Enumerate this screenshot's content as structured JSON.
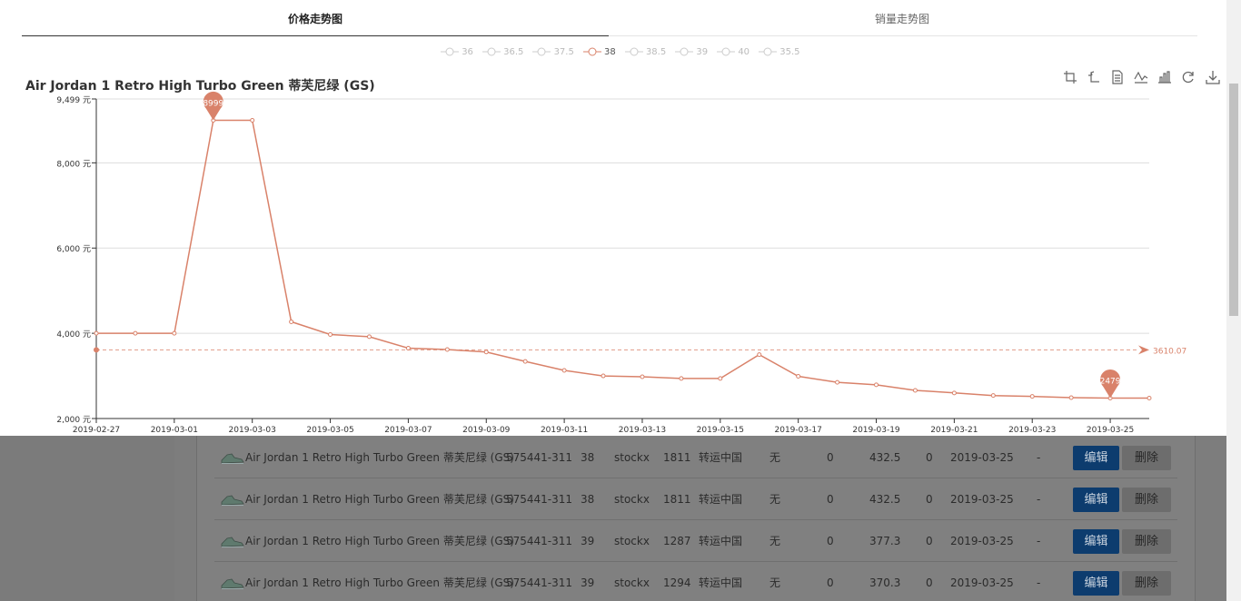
{
  "tabs": [
    {
      "label": "价格走势图",
      "active": true
    },
    {
      "label": "销量走势图",
      "active": false
    }
  ],
  "legend": [
    {
      "label": "36",
      "selected": false
    },
    {
      "label": "36.5",
      "selected": false
    },
    {
      "label": "37.5",
      "selected": false
    },
    {
      "label": "38",
      "selected": true
    },
    {
      "label": "38.5",
      "selected": false
    },
    {
      "label": "39",
      "selected": false
    },
    {
      "label": "40",
      "selected": false
    },
    {
      "label": "35.5",
      "selected": false
    }
  ],
  "toolbox": [
    "crop-icon",
    "crop-back-icon",
    "data-view-icon",
    "line-chart-icon",
    "bar-chart-icon",
    "refresh-icon",
    "download-icon"
  ],
  "colors": {
    "series": "#d9826a",
    "mark": "#d9826a",
    "grid": "#dddddd",
    "axis": "#333333"
  },
  "chart_data": {
    "type": "line",
    "title": "Air Jordan 1 Retro High Turbo Green 蒂芙尼绿 (GS)",
    "x": [
      "2019-02-27",
      "2019-02-28",
      "2019-03-01",
      "2019-03-02",
      "2019-03-03",
      "2019-03-04",
      "2019-03-05",
      "2019-03-06",
      "2019-03-07",
      "2019-03-08",
      "2019-03-09",
      "2019-03-10",
      "2019-03-11",
      "2019-03-12",
      "2019-03-13",
      "2019-03-14",
      "2019-03-15",
      "2019-03-16",
      "2019-03-17",
      "2019-03-18",
      "2019-03-19",
      "2019-03-20",
      "2019-03-21",
      "2019-03-22",
      "2019-03-23",
      "2019-03-24",
      "2019-03-25",
      "2019-03-26"
    ],
    "x_tick_labels": [
      "2019-02-27",
      "2019-03-01",
      "2019-03-03",
      "2019-03-05",
      "2019-03-07",
      "2019-03-09",
      "2019-03-11",
      "2019-03-13",
      "2019-03-15",
      "2019-03-17",
      "2019-03-19",
      "2019-03-21",
      "2019-03-23",
      "2019-03-25"
    ],
    "series": [
      {
        "name": "38",
        "values": [
          4000,
          4000,
          4000,
          8999,
          8999,
          4270,
          3970,
          3920,
          3650,
          3620,
          3560,
          3340,
          3130,
          3000,
          2980,
          2940,
          2940,
          3500,
          2990,
          2850,
          2790,
          2660,
          2600,
          2540,
          2520,
          2490,
          2479,
          2479
        ]
      }
    ],
    "ylim": [
      2000,
      9499
    ],
    "y_ticks": [
      "9,499 元",
      "8,000 元",
      "6,000 元",
      "4,000 元",
      "2,000 元"
    ],
    "y_tick_values": [
      9499,
      8000,
      6000,
      4000,
      2000
    ],
    "markers": [
      {
        "label": "8999",
        "value": 8999,
        "x": "2019-03-02"
      },
      {
        "label": "2479",
        "value": 2479,
        "x": "2019-03-25"
      }
    ],
    "average_line": {
      "value": 3610.07,
      "label": "3610.07"
    },
    "grid": true
  },
  "table": {
    "rows": [
      {
        "name": "Air Jordan 1 Retro High Turbo Green 蒂芙尼绿 (GS)",
        "sku": "575441-311",
        "size": "38",
        "source": "stockx",
        "qty": "1811",
        "ship": "转运中国",
        "flag": "无",
        "c1": "0",
        "price": "432.5",
        "c2": "0",
        "date": "2019-03-25",
        "note": "-",
        "edit": "编辑",
        "delete": "删除"
      },
      {
        "name": "Air Jordan 1 Retro High Turbo Green 蒂芙尼绿 (GS)",
        "sku": "575441-311",
        "size": "38",
        "source": "stockx",
        "qty": "1811",
        "ship": "转运中国",
        "flag": "无",
        "c1": "0",
        "price": "432.5",
        "c2": "0",
        "date": "2019-03-25",
        "note": "-",
        "edit": "编辑",
        "delete": "删除"
      },
      {
        "name": "Air Jordan 1 Retro High Turbo Green 蒂芙尼绿 (GS)",
        "sku": "575441-311",
        "size": "39",
        "source": "stockx",
        "qty": "1287",
        "ship": "转运中国",
        "flag": "无",
        "c1": "0",
        "price": "377.3",
        "c2": "0",
        "date": "2019-03-25",
        "note": "-",
        "edit": "编辑",
        "delete": "删除"
      },
      {
        "name": "Air Jordan 1 Retro High Turbo Green 蒂芙尼绿 (GS)",
        "sku": "575441-311",
        "size": "39",
        "source": "stockx",
        "qty": "1294",
        "ship": "转运中国",
        "flag": "无",
        "c1": "0",
        "price": "370.3",
        "c2": "0",
        "date": "2019-03-25",
        "note": "-",
        "edit": "编辑",
        "delete": "删除"
      }
    ]
  }
}
